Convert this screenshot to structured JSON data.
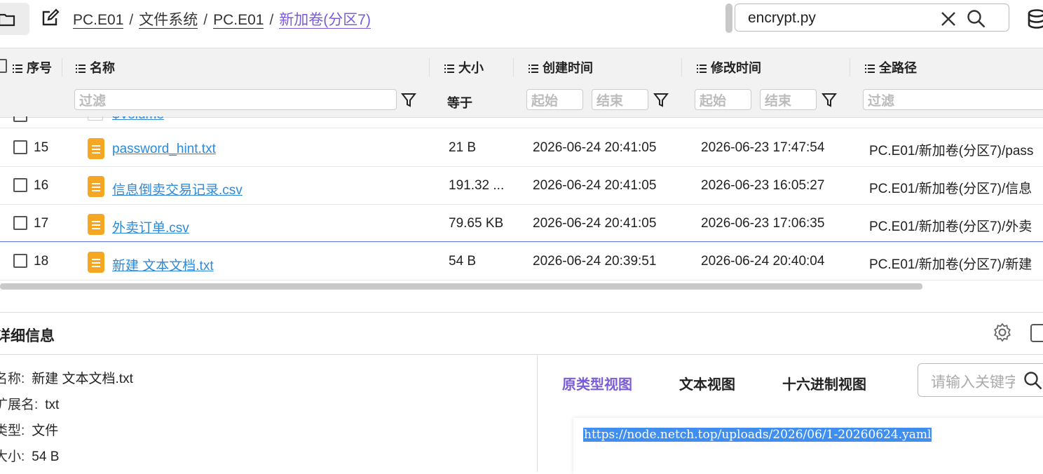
{
  "breadcrumb": {
    "items": [
      "PC.E01",
      "文件系统",
      "PC.E01",
      "新加卷(分区7)"
    ],
    "separator": "/"
  },
  "search": {
    "value": "encrypt.py"
  },
  "table": {
    "columns": {
      "index": "序号",
      "name": "名称",
      "size": "大小",
      "created": "创建时间",
      "modified": "修改时间",
      "path": "全路径"
    },
    "filters": {
      "name_placeholder": "过滤",
      "size_op": "等于",
      "created_start": "起始",
      "created_end": "结束",
      "modified_start": "起始",
      "modified_end": "结束",
      "path_placeholder": "过滤"
    },
    "partial_row_name": "$Volume",
    "rows": [
      {
        "index": "15",
        "name": "password_hint.txt",
        "size": "21 B",
        "created": "2026-06-24 20:41:05",
        "modified": "2026-06-23 17:47:54",
        "path": "PC.E01/新加卷(分区7)/pass"
      },
      {
        "index": "16",
        "name": "信息倒卖交易记录.csv",
        "size": "191.32 ...",
        "created": "2026-06-24 20:41:05",
        "modified": "2026-06-23 16:05:27",
        "path": "PC.E01/新加卷(分区7)/信息"
      },
      {
        "index": "17",
        "name": "外卖订单.csv",
        "size": "79.65 KB",
        "created": "2026-06-24 20:41:05",
        "modified": "2026-06-23 17:06:35",
        "path": "PC.E01/新加卷(分区7)/外卖"
      },
      {
        "index": "18",
        "name": "新建 文本文档.txt",
        "size": "54 B",
        "created": "2026-06-24 20:39:51",
        "modified": "2026-06-24 20:40:04",
        "path": "PC.E01/新加卷(分区7)/新建"
      }
    ]
  },
  "detail": {
    "title": "详细信息",
    "props": [
      {
        "key": "名称:",
        "value": "新建 文本文档.txt"
      },
      {
        "key": "扩展名:",
        "value": "txt"
      },
      {
        "key": "类型:",
        "value": "文件"
      },
      {
        "key": "大小:",
        "value": "54 B"
      }
    ],
    "tabs": [
      "原类型视图",
      "文本视图",
      "十六进制视图"
    ],
    "keyword_placeholder": "请输入关键字",
    "content": "https://node.netch.top/uploads/2026/06/1-20260624.yaml"
  },
  "colors": {
    "accent": "#7b5cd6",
    "link": "#2d8ad8",
    "file_icon": "#f5a623",
    "selection": "#3f8ef0"
  }
}
